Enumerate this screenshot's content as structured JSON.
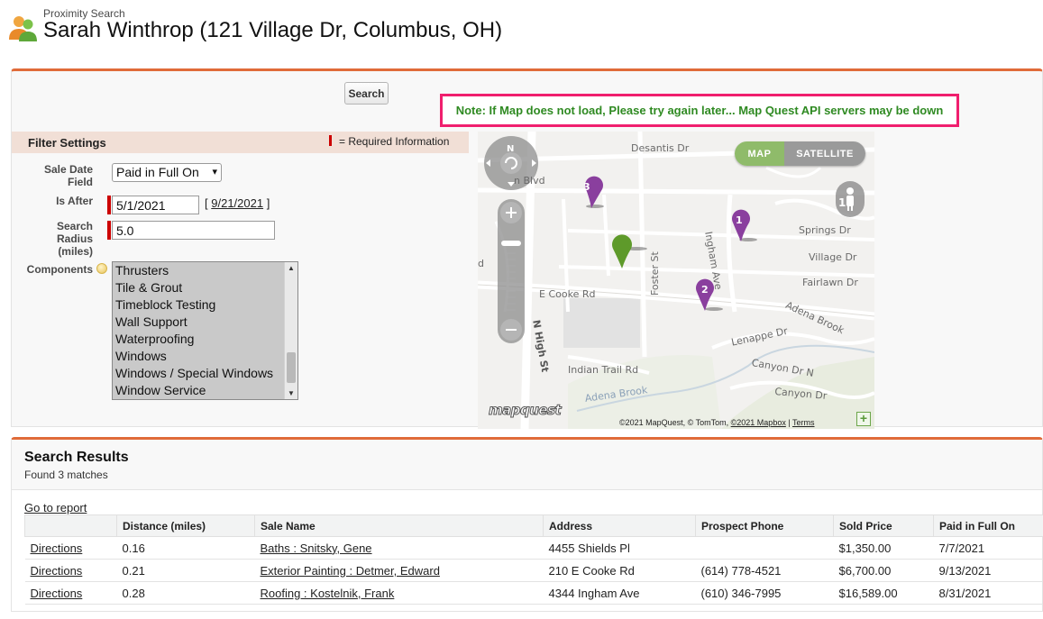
{
  "header": {
    "subtitle": "Proximity Search",
    "title": "Sarah Winthrop (121 Village Dr, Columbus, OH)"
  },
  "toolbar": {
    "search_label": "Search",
    "note": "Note: If Map does not load, Please try again later... Map Quest API servers may be down"
  },
  "filter": {
    "title": "Filter Settings",
    "required_legend": "= Required Information",
    "sale_date_field_label": "Sale Date Field",
    "sale_date_field_value": "Paid in Full On",
    "is_after_label": "Is After",
    "is_after_value": "5/1/2021",
    "is_after_today_open": "[",
    "is_after_today_link": "9/21/2021",
    "is_after_today_close": "]",
    "radius_label": "Search Radius (miles)",
    "radius_value": "5.0",
    "components_label": "Components",
    "components_options": [
      "Thrusters",
      "Tile & Grout",
      "Timeblock Testing",
      "Wall Support",
      "Waterproofing",
      "Windows",
      "Windows / Special Windows",
      "Window Service"
    ]
  },
  "map": {
    "toggle_map": "MAP",
    "toggle_satellite": "SATELLITE",
    "compass_n": "N",
    "streets": [
      "Desantis Dr",
      "n Blvd",
      "Springs Dr",
      "Village Dr",
      "Fairlawn Dr",
      "E Cooke Rd",
      "Ingham Ave",
      "Foster St",
      "N High St",
      "Adena Brook",
      "Lenappe Dr",
      "Canyon Dr N",
      "Canyon Dr",
      "Indian Trail Rd",
      "d"
    ],
    "markers": [
      "1",
      "2",
      "3"
    ],
    "logo": "mapquest",
    "attribution_text": "©2021 MapQuest, © TomTom, ",
    "attribution_link1": "©2021 Mapbox",
    "attribution_sep": " | ",
    "attribution_link2": "Terms",
    "colors": {
      "marker_purple": "#8a3f9e",
      "marker_green": "#5e9a2a",
      "accent": "#e06b39",
      "note_border": "#f01f6e",
      "note_text": "#2f8a22"
    }
  },
  "results": {
    "title": "Search Results",
    "count": "Found 3 matches",
    "goto_report": "Go to report",
    "columns": [
      "",
      "Distance (miles)",
      "Sale Name",
      "Address",
      "Prospect Phone",
      "Sold Price",
      "Paid in Full On"
    ],
    "rows": [
      {
        "action": "Directions",
        "distance": "0.16",
        "sale_name": "Baths : Snitsky, Gene",
        "address": "4455 Shields Pl",
        "phone": "",
        "price": "$1,350.00",
        "paid": "7/7/2021"
      },
      {
        "action": "Directions",
        "distance": "0.21",
        "sale_name": "Exterior Painting : Detmer, Edward",
        "address": "210 E Cooke Rd",
        "phone": "(614) 778-4521",
        "price": "$6,700.00",
        "paid": "9/13/2021"
      },
      {
        "action": "Directions",
        "distance": "0.28",
        "sale_name": "Roofing : Kostelnik, Frank",
        "address": "4344 Ingham Ave",
        "phone": "(610) 346-7995",
        "price": "$16,589.00",
        "paid": "8/31/2021"
      }
    ]
  }
}
